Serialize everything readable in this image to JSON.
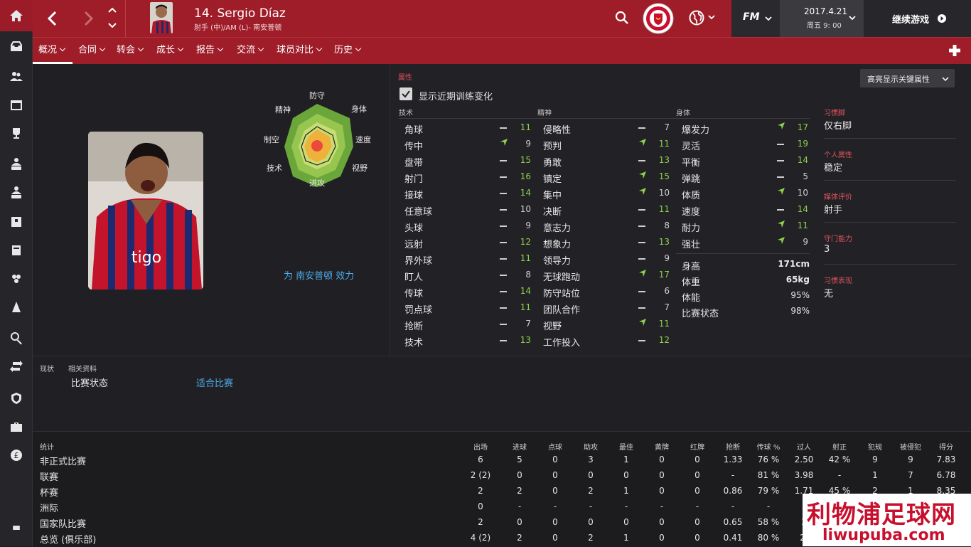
{
  "header": {
    "player_name": "14. Sergio Díaz",
    "player_sub": "射手 (中)/AM (L)- 南安普顿",
    "date": "2017.4.21",
    "day_time": "周五 9: 00",
    "continue_label": "继续游戏",
    "fm_label": "FM"
  },
  "nav": {
    "tabs": [
      {
        "label": "概况"
      },
      {
        "label": "合同"
      },
      {
        "label": "转会"
      },
      {
        "label": "成长"
      },
      {
        "label": "报告"
      },
      {
        "label": "交流"
      },
      {
        "label": "球员对比"
      },
      {
        "label": "历史"
      }
    ]
  },
  "radar": {
    "labels": [
      "防守",
      "身体",
      "速度",
      "视野",
      "进攻",
      "技术",
      "制空",
      "精神"
    ]
  },
  "play_for": "为 南安普顿 效力",
  "attributes": {
    "section_label": "属性",
    "highlight_label": "高亮显示关键属性",
    "show_training_label": "显示近期训练变化",
    "technical_label": "技术",
    "mental_label": "精神",
    "physical_label": "身体",
    "technical": [
      {
        "name": "角球",
        "value": "11",
        "trend": "flat"
      },
      {
        "name": "传中",
        "value": "9",
        "trend": "up"
      },
      {
        "name": "盘带",
        "value": "15",
        "trend": "flat"
      },
      {
        "name": "射门",
        "value": "16",
        "trend": "flat"
      },
      {
        "name": "接球",
        "value": "14",
        "trend": "flat"
      },
      {
        "name": "任意球",
        "value": "10",
        "trend": "flat"
      },
      {
        "name": "头球",
        "value": "9",
        "trend": "flat"
      },
      {
        "name": "远射",
        "value": "12",
        "trend": "flat"
      },
      {
        "name": "界外球",
        "value": "11",
        "trend": "flat"
      },
      {
        "name": "盯人",
        "value": "8",
        "trend": "flat"
      },
      {
        "name": "传球",
        "value": "14",
        "trend": "flat"
      },
      {
        "name": "罚点球",
        "value": "11",
        "trend": "flat"
      },
      {
        "name": "抢断",
        "value": "7",
        "trend": "flat"
      },
      {
        "name": "技术",
        "value": "13",
        "trend": "flat"
      }
    ],
    "mental": [
      {
        "name": "侵略性",
        "value": "7",
        "trend": "flat"
      },
      {
        "name": "预判",
        "value": "11",
        "trend": "up"
      },
      {
        "name": "勇敢",
        "value": "13",
        "trend": "flat"
      },
      {
        "name": "镇定",
        "value": "15",
        "trend": "up"
      },
      {
        "name": "集中",
        "value": "10",
        "trend": "up"
      },
      {
        "name": "决断",
        "value": "11",
        "trend": "flat"
      },
      {
        "name": "意志力",
        "value": "8",
        "trend": "flat"
      },
      {
        "name": "想象力",
        "value": "13",
        "trend": "flat"
      },
      {
        "name": "领导力",
        "value": "9",
        "trend": "flat"
      },
      {
        "name": "无球跑动",
        "value": "17",
        "trend": "up"
      },
      {
        "name": "防守站位",
        "value": "6",
        "trend": "flat"
      },
      {
        "name": "团队合作",
        "value": "7",
        "trend": "flat"
      },
      {
        "name": "视野",
        "value": "11",
        "trend": "up"
      },
      {
        "name": "工作投入",
        "value": "12",
        "trend": "flat"
      }
    ],
    "physical": [
      {
        "name": "爆发力",
        "value": "17",
        "trend": "up"
      },
      {
        "name": "灵活",
        "value": "19",
        "trend": "flat"
      },
      {
        "name": "平衡",
        "value": "14",
        "trend": "flat"
      },
      {
        "name": "弹跳",
        "value": "5",
        "trend": "flat"
      },
      {
        "name": "体质",
        "value": "10",
        "trend": "up"
      },
      {
        "name": "速度",
        "value": "14",
        "trend": "flat"
      },
      {
        "name": "耐力",
        "value": "11",
        "trend": "up"
      },
      {
        "name": "强壮",
        "value": "9",
        "trend": "up"
      }
    ],
    "info": [
      {
        "name": "身高",
        "value": "171cm"
      },
      {
        "name": "体重",
        "value": "65kg"
      },
      {
        "name": "体能",
        "value": "95%"
      },
      {
        "name": "比赛状态",
        "value": "98%"
      }
    ]
  },
  "profile": [
    {
      "label": "习惯脚",
      "value": "仅右脚"
    },
    {
      "label": "个人属性",
      "value": "稳定"
    },
    {
      "label": "媒体评价",
      "value": "射手"
    },
    {
      "label": "守门能力",
      "value": "3"
    },
    {
      "label": "习惯表现",
      "value": "无"
    }
  ],
  "status": {
    "tabs": [
      "现状",
      "相关资料"
    ],
    "key": "比赛状态",
    "value": "适合比赛"
  },
  "stats": {
    "title": "统计",
    "headers": [
      "出场",
      "进球",
      "点球",
      "助攻",
      "最佳",
      "黄牌",
      "红牌",
      "抢断",
      "传球 %",
      "过人",
      "射正",
      "犯规",
      "被侵犯",
      "得分"
    ],
    "rows": [
      {
        "label": "非正式比赛",
        "cells": [
          "6",
          "5",
          "0",
          "3",
          "1",
          "0",
          "0",
          "1.33",
          "76 %",
          "2.50",
          "42 %",
          "9",
          "9",
          "7.83"
        ]
      },
      {
        "label": "联赛",
        "cells": [
          "2 (2)",
          "0",
          "0",
          "0",
          "0",
          "0",
          "0",
          "-",
          "81 %",
          "3.98",
          "-",
          "1",
          "7",
          "6.78"
        ]
      },
      {
        "label": "杯赛",
        "cells": [
          "2",
          "2",
          "0",
          "2",
          "1",
          "0",
          "0",
          "0.86",
          "79 %",
          "1.71",
          "45 %",
          "2",
          "1",
          "8.35"
        ]
      },
      {
        "label": "洲际",
        "cells": [
          "0",
          "-",
          "-",
          "-",
          "-",
          "-",
          "-",
          "-",
          "-",
          "",
          "",
          "",
          "",
          ""
        ]
      },
      {
        "label": "国家队比赛",
        "cells": [
          "2",
          "0",
          "0",
          "0",
          "0",
          "0",
          "0",
          "0.65",
          "58 %",
          "3",
          "",
          "",
          "",
          ""
        ]
      },
      {
        "label": "总览 (俱乐部)",
        "cells": [
          "4 (2)",
          "2",
          "0",
          "2",
          "1",
          "0",
          "0",
          "0.41",
          "80 %",
          "2.",
          "",
          "",
          "",
          ""
        ]
      }
    ]
  },
  "watermark": {
    "line1": "利物浦足球网",
    "line2": "liwupuba.com"
  },
  "colors": {
    "accent": "#9e1d29",
    "up_arrow": "#8ed14b"
  }
}
